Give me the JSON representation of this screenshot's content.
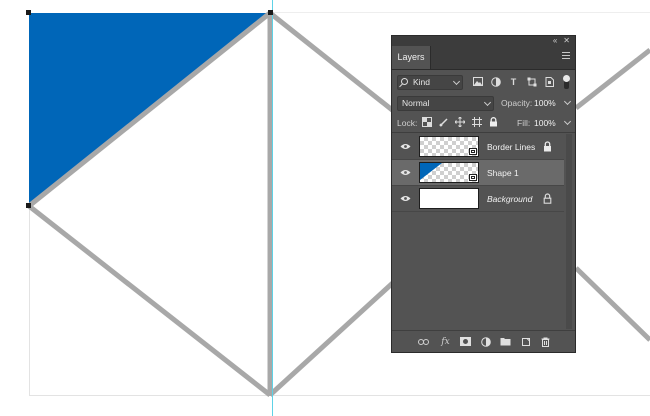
{
  "panel": {
    "title": "Layers",
    "filter": {
      "kind_label": "Kind"
    },
    "blend_mode": "Normal",
    "opacity_label": "Opacity:",
    "opacity_value": "100%",
    "lock_label": "Lock:",
    "fill_label": "Fill:",
    "fill_value": "100%",
    "layers": [
      {
        "name": "Border Lines",
        "visible": true,
        "locked": true,
        "selected": false
      },
      {
        "name": "Shape 1",
        "visible": true,
        "locked": false,
        "selected": true
      },
      {
        "name": "Background",
        "visible": true,
        "locked": true,
        "selected": false
      }
    ],
    "bottom_icons": [
      "link-icon",
      "fx-icon",
      "mask-icon",
      "adjustment-icon",
      "folder-icon",
      "new-layer-icon",
      "trash-icon"
    ]
  },
  "colors": {
    "shape_fill": "#0066b8",
    "border_lines": "#a8a8a8",
    "guide": "#5ed2e6",
    "panel_bg": "#535353",
    "selected_row": "#6a6a6a"
  }
}
